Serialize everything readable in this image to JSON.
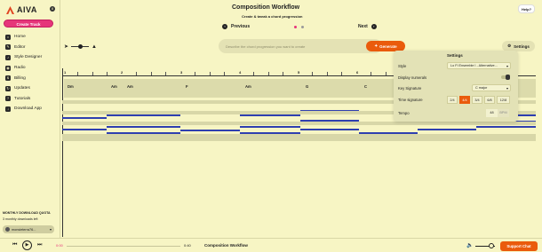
{
  "app": {
    "name": "AIVA",
    "badge": "8"
  },
  "sidebar": {
    "create_label": "Create Track",
    "items": [
      {
        "label": "Home",
        "icon": "home-icon"
      },
      {
        "label": "Editor",
        "icon": "editor-icon"
      },
      {
        "label": "Style Designer",
        "icon": "style-designer-icon"
      },
      {
        "label": "Radio",
        "icon": "radio-icon"
      },
      {
        "label": "Billing",
        "icon": "billing-icon"
      },
      {
        "label": "Updates",
        "icon": "updates-icon"
      },
      {
        "label": "Tutorials",
        "icon": "tutorials-icon"
      },
      {
        "label": "Download App",
        "icon": "download-icon"
      }
    ],
    "quota_title": "MONTHLY DOWNLOAD QUOTA",
    "quota_text": "3 monthly downloads left",
    "username": "monsieterra76..."
  },
  "header": {
    "title": "Composition Workflow",
    "subtitle": "Create & tweak a chord progression",
    "prev_label": "Previous",
    "next_label": "Next",
    "help_label": "Help?",
    "step_dots": [
      "#e6357a",
      "#9a9a9a"
    ]
  },
  "toolbar": {
    "prompt_placeholder": "Describe the chord progression you want to create",
    "generate_label": "Generate",
    "settings_label": "Settings"
  },
  "editor": {
    "bars": [
      "1",
      "2",
      "3",
      "4",
      "5",
      "6"
    ],
    "chords": [
      "Dm",
      "Am",
      "Am",
      "F",
      "Am",
      "G",
      "C"
    ]
  },
  "settings_panel": {
    "title": "Settings",
    "style_label": "Style",
    "style_value": "Lo Fi Ensemble I - Alternative...",
    "numerals_label": "Display numerals",
    "key_label": "Key Signature",
    "key_value": "C major",
    "time_label": "Time signature",
    "time_options": [
      "2/4",
      "4/4",
      "3/4",
      "6/8",
      "12/8"
    ],
    "time_selected": "4/4",
    "tempo_label": "Tempo",
    "tempo_value": "48",
    "tempo_unit": "BPM"
  },
  "player": {
    "time_start": "0:00",
    "time_end": "0:40",
    "track_title": "Composition Workflow",
    "support_label": "Support Chat"
  },
  "colors": {
    "accent_pink": "#e6357a",
    "accent_orange": "#ea5b0c",
    "note_blue": "#2f3fb0",
    "background": "#f7f5c4"
  }
}
